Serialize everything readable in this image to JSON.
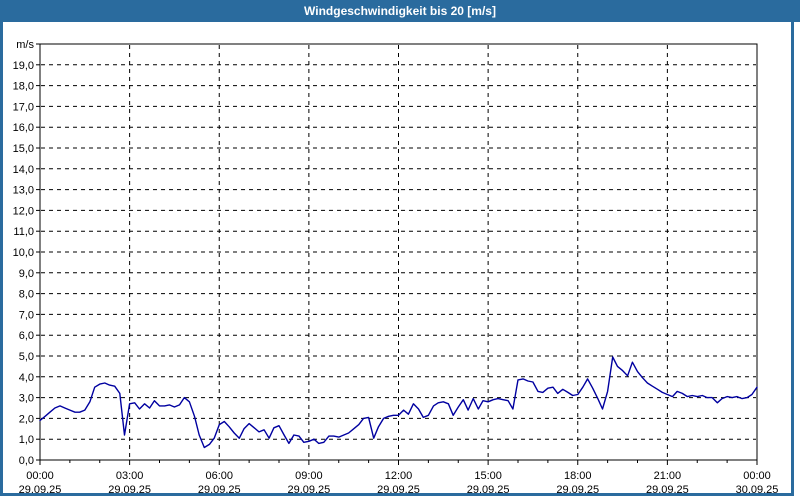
{
  "title_bar": {
    "text": "Windgeschwindigkeit bis 20 [m/s]"
  },
  "colors": {
    "title_bar_bg": "#2a6b9e",
    "frame": "#2a6b9e",
    "title_text": "#ffffff",
    "line": "#0000a0",
    "grid": "#000000",
    "axis": "#000000",
    "plot_bg": "#ffffff",
    "label_text": "#000000"
  },
  "chart_data": {
    "type": "line",
    "title": "Windgeschwindigkeit bis 20 [m/s]",
    "ylabel": "m/s",
    "xlabel": "",
    "ylim": [
      0,
      20
    ],
    "y_tick_step": 1,
    "y_label_decimal_separator": ",",
    "grid": "dashed",
    "legend": "none",
    "x_hours": [
      0,
      24
    ],
    "x_minor_tick_every_hours": 1,
    "x_major_ticks": [
      {
        "hour": 0,
        "time": "00:00",
        "date": "29.09.25"
      },
      {
        "hour": 3,
        "time": "03:00",
        "date": "29.09.25"
      },
      {
        "hour": 6,
        "time": "06:00",
        "date": "29.09.25"
      },
      {
        "hour": 9,
        "time": "09:00",
        "date": "29.09.25"
      },
      {
        "hour": 12,
        "time": "12:00",
        "date": "29.09.25"
      },
      {
        "hour": 15,
        "time": "15:00",
        "date": "29.09.25"
      },
      {
        "hour": 18,
        "time": "18:00",
        "date": "29.09.25"
      },
      {
        "hour": 21,
        "time": "21:00",
        "date": "29.09.25"
      },
      {
        "hour": 24,
        "time": "00:00",
        "date": "30.09.25"
      }
    ],
    "series": [
      {
        "name": "Windgeschwindigkeit",
        "unit": "m/s",
        "color": "#0000a0",
        "points": [
          [
            0.0,
            1.9
          ],
          [
            0.17,
            2.1
          ],
          [
            0.33,
            2.3
          ],
          [
            0.5,
            2.5
          ],
          [
            0.67,
            2.6
          ],
          [
            0.83,
            2.5
          ],
          [
            1.0,
            2.4
          ],
          [
            1.17,
            2.3
          ],
          [
            1.33,
            2.3
          ],
          [
            1.5,
            2.4
          ],
          [
            1.67,
            2.8
          ],
          [
            1.83,
            3.5
          ],
          [
            2.0,
            3.65
          ],
          [
            2.17,
            3.7
          ],
          [
            2.33,
            3.6
          ],
          [
            2.5,
            3.55
          ],
          [
            2.67,
            3.2
          ],
          [
            2.83,
            1.2
          ],
          [
            3.0,
            2.7
          ],
          [
            3.17,
            2.75
          ],
          [
            3.33,
            2.45
          ],
          [
            3.5,
            2.7
          ],
          [
            3.67,
            2.5
          ],
          [
            3.83,
            2.85
          ],
          [
            4.0,
            2.6
          ],
          [
            4.17,
            2.6
          ],
          [
            4.33,
            2.65
          ],
          [
            4.5,
            2.55
          ],
          [
            4.67,
            2.65
          ],
          [
            4.83,
            3.0
          ],
          [
            5.0,
            2.8
          ],
          [
            5.17,
            2.1
          ],
          [
            5.33,
            1.2
          ],
          [
            5.5,
            0.6
          ],
          [
            5.67,
            0.75
          ],
          [
            5.83,
            1.05
          ],
          [
            6.0,
            1.7
          ],
          [
            6.17,
            1.85
          ],
          [
            6.33,
            1.6
          ],
          [
            6.5,
            1.3
          ],
          [
            6.67,
            1.05
          ],
          [
            6.83,
            1.5
          ],
          [
            7.0,
            1.75
          ],
          [
            7.17,
            1.55
          ],
          [
            7.33,
            1.35
          ],
          [
            7.5,
            1.45
          ],
          [
            7.67,
            1.05
          ],
          [
            7.83,
            1.55
          ],
          [
            8.0,
            1.65
          ],
          [
            8.17,
            1.2
          ],
          [
            8.33,
            0.8
          ],
          [
            8.5,
            1.2
          ],
          [
            8.67,
            1.15
          ],
          [
            8.83,
            0.85
          ],
          [
            9.0,
            0.9
          ],
          [
            9.17,
            1.0
          ],
          [
            9.33,
            0.8
          ],
          [
            9.5,
            0.85
          ],
          [
            9.67,
            1.15
          ],
          [
            9.83,
            1.15
          ],
          [
            10.0,
            1.1
          ],
          [
            10.17,
            1.2
          ],
          [
            10.33,
            1.3
          ],
          [
            10.5,
            1.5
          ],
          [
            10.67,
            1.7
          ],
          [
            10.83,
            2.0
          ],
          [
            11.0,
            2.05
          ],
          [
            11.17,
            1.05
          ],
          [
            11.33,
            1.6
          ],
          [
            11.5,
            2.0
          ],
          [
            11.67,
            2.1
          ],
          [
            11.83,
            2.15
          ],
          [
            12.0,
            2.15
          ],
          [
            12.17,
            2.4
          ],
          [
            12.33,
            2.2
          ],
          [
            12.5,
            2.7
          ],
          [
            12.67,
            2.45
          ],
          [
            12.83,
            2.05
          ],
          [
            13.0,
            2.15
          ],
          [
            13.17,
            2.6
          ],
          [
            13.33,
            2.75
          ],
          [
            13.5,
            2.8
          ],
          [
            13.67,
            2.7
          ],
          [
            13.83,
            2.15
          ],
          [
            14.0,
            2.55
          ],
          [
            14.17,
            2.9
          ],
          [
            14.33,
            2.4
          ],
          [
            14.5,
            2.95
          ],
          [
            14.67,
            2.45
          ],
          [
            14.83,
            2.85
          ],
          [
            15.0,
            2.8
          ],
          [
            15.17,
            2.9
          ],
          [
            15.33,
            2.95
          ],
          [
            15.5,
            2.9
          ],
          [
            15.67,
            2.85
          ],
          [
            15.83,
            2.45
          ],
          [
            16.0,
            3.85
          ],
          [
            16.17,
            3.9
          ],
          [
            16.33,
            3.8
          ],
          [
            16.5,
            3.75
          ],
          [
            16.67,
            3.3
          ],
          [
            16.83,
            3.25
          ],
          [
            17.0,
            3.45
          ],
          [
            17.17,
            3.5
          ],
          [
            17.33,
            3.2
          ],
          [
            17.5,
            3.4
          ],
          [
            17.67,
            3.25
          ],
          [
            17.83,
            3.1
          ],
          [
            18.0,
            3.15
          ],
          [
            18.17,
            3.5
          ],
          [
            18.33,
            3.9
          ],
          [
            18.5,
            3.45
          ],
          [
            18.67,
            2.95
          ],
          [
            18.83,
            2.45
          ],
          [
            19.0,
            3.3
          ],
          [
            19.17,
            4.95
          ],
          [
            19.33,
            4.5
          ],
          [
            19.5,
            4.3
          ],
          [
            19.67,
            4.05
          ],
          [
            19.83,
            4.7
          ],
          [
            20.0,
            4.25
          ],
          [
            20.17,
            3.95
          ],
          [
            20.33,
            3.7
          ],
          [
            20.5,
            3.55
          ],
          [
            20.67,
            3.4
          ],
          [
            20.83,
            3.25
          ],
          [
            21.0,
            3.15
          ],
          [
            21.17,
            3.05
          ],
          [
            21.33,
            3.3
          ],
          [
            21.5,
            3.2
          ],
          [
            21.67,
            3.05
          ],
          [
            21.83,
            3.1
          ],
          [
            22.0,
            3.05
          ],
          [
            22.17,
            3.1
          ],
          [
            22.33,
            3.0
          ],
          [
            22.5,
            3.0
          ],
          [
            22.67,
            2.75
          ],
          [
            22.83,
            2.95
          ],
          [
            23.0,
            3.05
          ],
          [
            23.17,
            3.0
          ],
          [
            23.33,
            3.05
          ],
          [
            23.5,
            2.95
          ],
          [
            23.67,
            3.0
          ],
          [
            23.83,
            3.15
          ],
          [
            24.0,
            3.5
          ]
        ]
      }
    ]
  }
}
